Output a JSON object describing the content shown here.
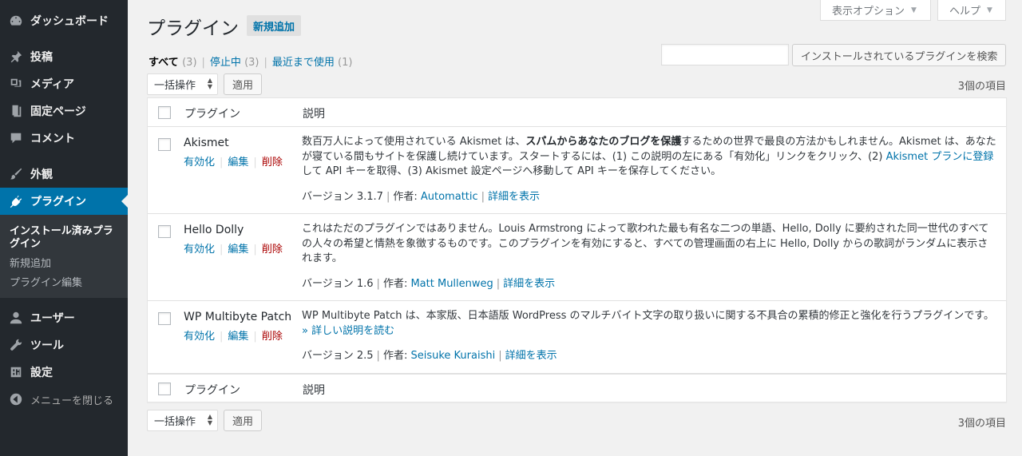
{
  "sidebar": {
    "items": [
      {
        "label": "ダッシュボード",
        "icon": "dashboard-icon"
      },
      {
        "label": "投稿",
        "icon": "pin-icon"
      },
      {
        "label": "メディア",
        "icon": "media-icon"
      },
      {
        "label": "固定ページ",
        "icon": "page-icon"
      },
      {
        "label": "コメント",
        "icon": "comment-icon"
      },
      {
        "label": "外観",
        "icon": "brush-icon"
      },
      {
        "label": "プラグイン",
        "icon": "plugin-icon"
      },
      {
        "label": "ユーザー",
        "icon": "user-icon"
      },
      {
        "label": "ツール",
        "icon": "wrench-icon"
      },
      {
        "label": "設定",
        "icon": "settings-icon"
      }
    ],
    "submenu": [
      {
        "label": "インストール済みプラグイン"
      },
      {
        "label": "新規追加"
      },
      {
        "label": "プラグイン編集"
      }
    ],
    "collapse_label": "メニューを閉じる"
  },
  "screen_meta": {
    "options_label": "表示オプション",
    "help_label": "ヘルプ"
  },
  "header": {
    "title": "プラグイン",
    "add_new_label": "新規追加"
  },
  "filters": [
    {
      "label": "すべて",
      "count": "(3)"
    },
    {
      "label": "停止中",
      "count": "(3)"
    },
    {
      "label": "最近まで使用",
      "count": "(1)"
    }
  ],
  "search": {
    "value": "",
    "button_label": "インストールされているプラグインを検索"
  },
  "bulk": {
    "select_value": "一括操作",
    "apply_label": "適用",
    "item_count": "3個の項目"
  },
  "table": {
    "columns": {
      "plugin": "プラグイン",
      "description": "説明"
    },
    "rows": [
      {
        "name": "Akismet",
        "actions": {
          "activate": "有効化",
          "edit": "編集",
          "delete": "削除"
        },
        "desc": {
          "part1": "数百万人によって使用されている Akismet は、",
          "bold": "スパムからあなたのブログを保護",
          "part2": "するための世界で最良の方法かもしれません。Akismet は、あなたが寝ている間もサイトを保護し続けています。スタートするには、(1) この説明の左にある「有効化」リンクをクリック、(2) ",
          "link": "Akismet プランに登録",
          "part3": "して API キーを取得、(3) Akismet 設定ページへ移動して API キーを保存してください。"
        },
        "version": "バージョン 3.1.7",
        "author_label": "作者:",
        "author": "Automattic",
        "details": "詳細を表示"
      },
      {
        "name": "Hello Dolly",
        "actions": {
          "activate": "有効化",
          "edit": "編集",
          "delete": "削除"
        },
        "desc": {
          "part1": "これはただのプラグインではありません。Louis Armstrong によって歌われた最も有名な二つの単語、Hello, Dolly に要約された同一世代のすべての人々の希望と情熱を象徴するものです。このプラグインを有効にすると、すべての管理画面の右上に Hello, Dolly からの歌詞がランダムに表示されます。"
        },
        "version": "バージョン 1.6",
        "author_label": "作者:",
        "author": "Matt Mullenweg",
        "details": "詳細を表示"
      },
      {
        "name": "WP Multibyte Patch",
        "actions": {
          "activate": "有効化",
          "edit": "編集",
          "delete": "削除"
        },
        "desc": {
          "part1": "WP Multibyte Patch は、本家版、日本語版 WordPress のマルチバイト文字の取り扱いに関する不具合の累積的修正と強化を行うプラグインです。",
          "link": "» 詳しい説明を読む"
        },
        "version": "バージョン 2.5",
        "author_label": "作者:",
        "author": "Seisuke Kuraishi",
        "details": "詳細を表示"
      }
    ]
  }
}
